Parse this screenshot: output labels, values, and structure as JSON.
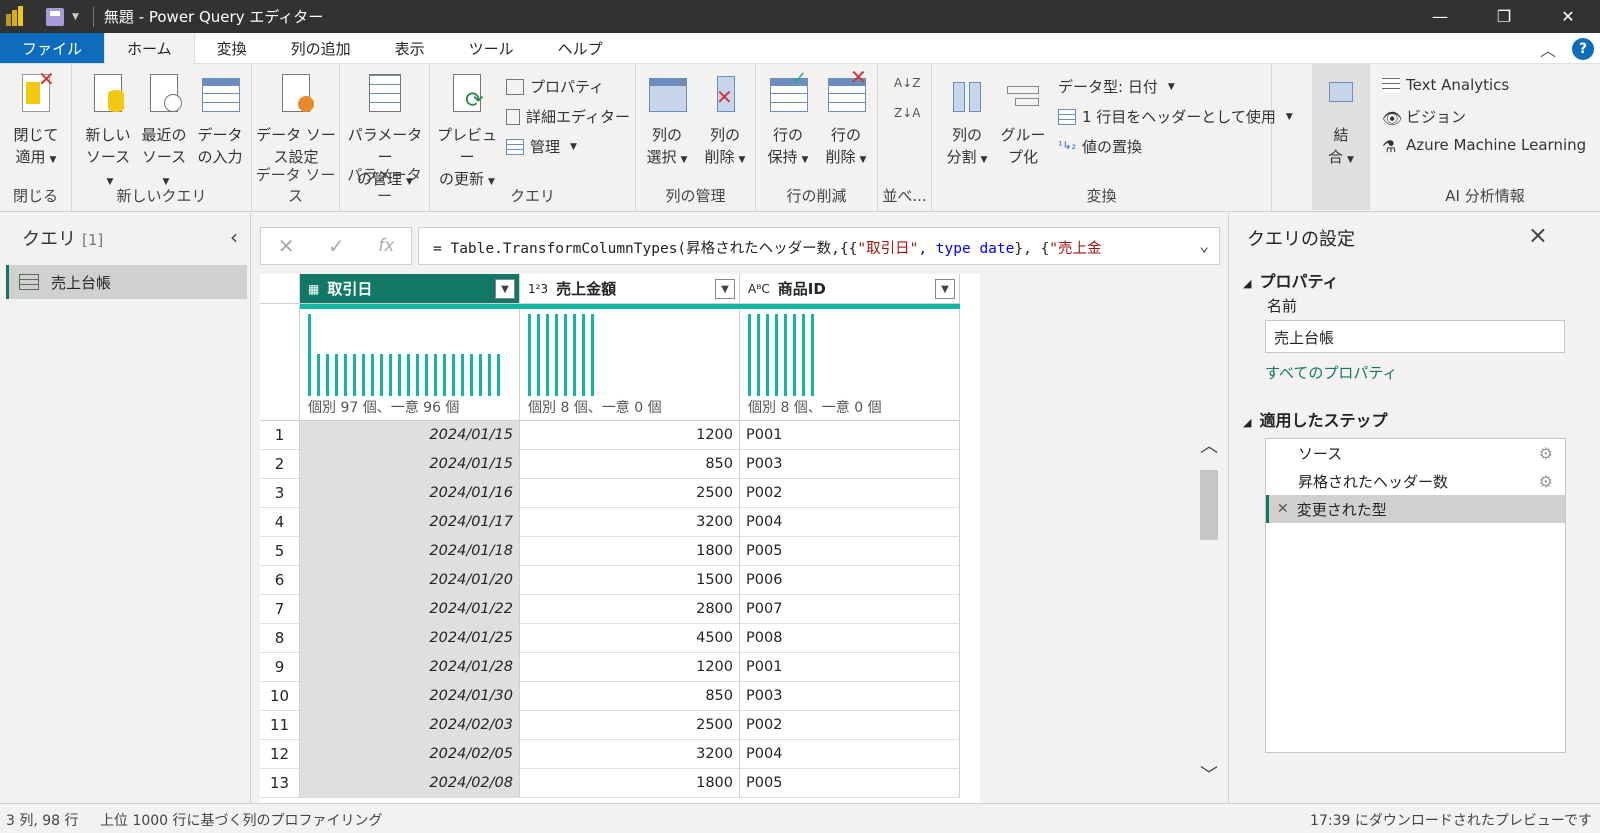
{
  "window": {
    "title": "無題 - Power Query エディター"
  },
  "menu": {
    "tabs": [
      "ファイル",
      "ホーム",
      "変換",
      "列の追加",
      "表示",
      "ツール",
      "ヘルプ"
    ]
  },
  "ribbon": {
    "groups": {
      "close": "閉じる",
      "new_query": "新しいクエリ",
      "data_source": "データ ソース",
      "parameters": "パラメーター",
      "query": "クエリ",
      "manage_columns": "列の管理",
      "reduce_rows": "行の削減",
      "sort": "並べ...",
      "transform": "変換",
      "ai_insights": "AI 分析情報"
    },
    "buttons": {
      "close_apply_1": "閉じて",
      "close_apply_2": "適用",
      "new_source_1": "新しい",
      "new_source_2": "ソース",
      "recent_sources_1": "最近の",
      "recent_sources_2": "ソース",
      "enter_data_1": "データ",
      "enter_data_2": "の入力",
      "data_source_settings_1": "データ ソー",
      "data_source_settings_2": "ス設定",
      "manage_parameters_1": "パラメーター",
      "manage_parameters_2": "の管理",
      "refresh_preview_1": "プレビュー",
      "refresh_preview_2": "の更新",
      "properties": "プロパティ",
      "advanced_editor": "詳細エディター",
      "manage": "管理",
      "choose_columns_1": "列の",
      "choose_columns_2": "選択",
      "remove_columns_1": "列の",
      "remove_columns_2": "削除",
      "keep_rows_1": "行の",
      "keep_rows_2": "保持",
      "remove_rows_1": "行の",
      "remove_rows_2": "削除",
      "split_column_1": "列の",
      "split_column_2": "分割",
      "group_by_1": "グルー",
      "group_by_2": "プ化",
      "data_type": "データ型: 日付",
      "use_first_row": "1 行目をヘッダーとして使用",
      "replace_values": "値の置換",
      "combine_1": "結",
      "combine_2": "合",
      "text_analytics": "Text Analytics",
      "vision": "ビジョン",
      "azure_ml": "Azure Machine Learning"
    }
  },
  "queries_pane": {
    "title": "クエリ",
    "count": "[1]",
    "items": [
      "売上台帳"
    ]
  },
  "formula_bar": {
    "prefix": "= Table.TransformColumnTypes(昇格されたヘッダー数,{{",
    "s1": "\"取引日\"",
    "mid1": ", ",
    "kw1": "type",
    "mid2": " ",
    "kw2": "date",
    "mid3": "}, {",
    "s2": "\"売上金"
  },
  "grid": {
    "columns": [
      {
        "name": "取引日",
        "type_icon": "calendar-table",
        "profile": "個別 97 個、一意 96 個"
      },
      {
        "name": "売上金額",
        "type_icon": "1²3",
        "profile": "個別 8 個、一意 0 個"
      },
      {
        "name": "商品ID",
        "type_icon": "AᴮC",
        "profile": "個別 8 個、一意 0 個"
      }
    ],
    "rows": [
      [
        "1",
        "2024/01/15",
        "1200",
        "P001"
      ],
      [
        "2",
        "2024/01/15",
        "850",
        "P003"
      ],
      [
        "3",
        "2024/01/16",
        "2500",
        "P002"
      ],
      [
        "4",
        "2024/01/17",
        "3200",
        "P004"
      ],
      [
        "5",
        "2024/01/18",
        "1800",
        "P005"
      ],
      [
        "6",
        "2024/01/20",
        "1500",
        "P006"
      ],
      [
        "7",
        "2024/01/22",
        "2800",
        "P007"
      ],
      [
        "8",
        "2024/01/25",
        "4500",
        "P008"
      ],
      [
        "9",
        "2024/01/28",
        "1200",
        "P001"
      ],
      [
        "10",
        "2024/01/30",
        "850",
        "P003"
      ],
      [
        "11",
        "2024/02/03",
        "2500",
        "P002"
      ],
      [
        "12",
        "2024/02/05",
        "3200",
        "P004"
      ],
      [
        "13",
        "2024/02/08",
        "1800",
        "P005"
      ]
    ]
  },
  "settings_pane": {
    "title": "クエリの設定",
    "properties_heading": "プロパティ",
    "name_label": "名前",
    "name_value": "売上台帳",
    "all_properties_link": "すべてのプロパティ",
    "steps_heading": "適用したステップ",
    "steps": [
      "ソース",
      "昇格されたヘッダー数",
      "変更された型"
    ]
  },
  "status": {
    "dims": "3 列, 98 行",
    "profiling": "上位 1000 行に基づく列のプロファイリング",
    "preview_time": "17:39 にダウンロードされたプレビューです"
  },
  "colors": {
    "accent": "#117865",
    "profile_bar": "#13b5a0",
    "file_tab": "#0f6cbd"
  }
}
